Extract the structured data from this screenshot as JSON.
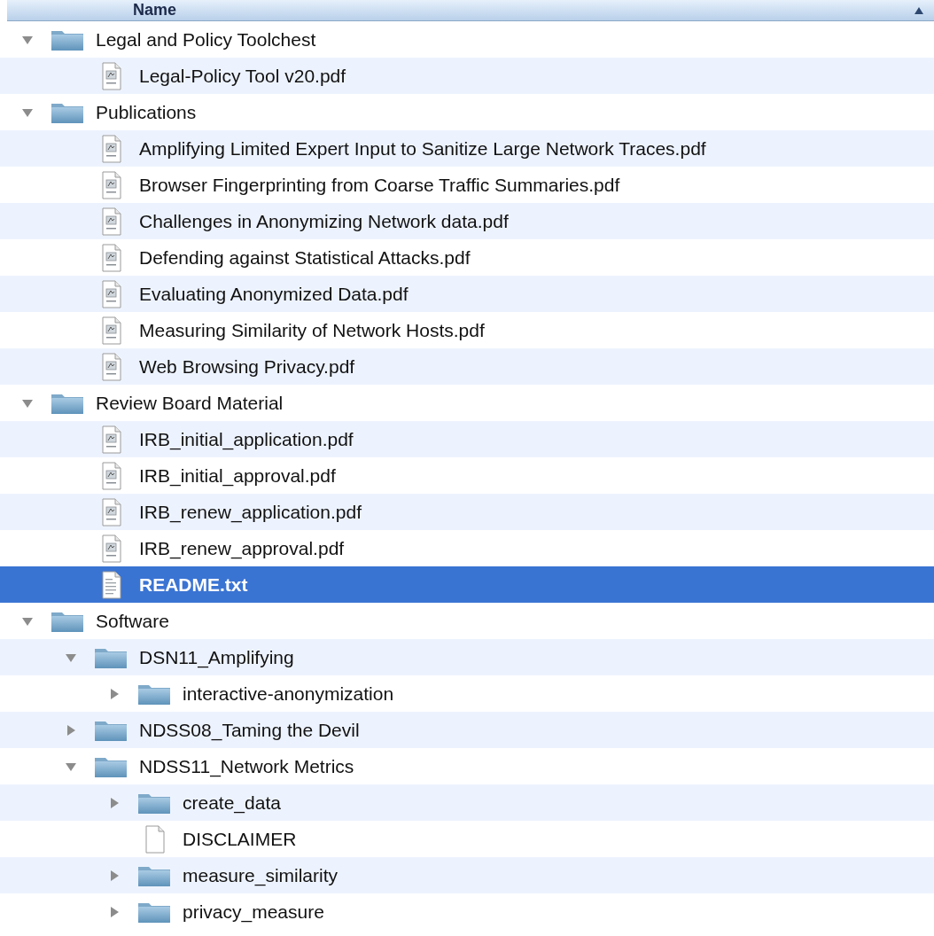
{
  "header": {
    "label": "Name"
  },
  "items": [
    {
      "kind": "folder",
      "name": "Legal and Policy Toolchest",
      "expanded": true,
      "selected": false,
      "children": [
        {
          "kind": "pdf",
          "name": "Legal-Policy Tool v20.pdf",
          "selected": false
        }
      ]
    },
    {
      "kind": "folder",
      "name": "Publications",
      "expanded": true,
      "selected": false,
      "children": [
        {
          "kind": "pdf",
          "name": "Amplifying Limited Expert Input to Sanitize Large Network Traces.pdf",
          "selected": false
        },
        {
          "kind": "pdf",
          "name": "Browser Fingerprinting from Coarse Traffic Summaries.pdf",
          "selected": false
        },
        {
          "kind": "pdf",
          "name": "Challenges in Anonymizing Network data.pdf",
          "selected": false
        },
        {
          "kind": "pdf",
          "name": "Defending against Statistical Attacks.pdf",
          "selected": false
        },
        {
          "kind": "pdf",
          "name": "Evaluating Anonymized Data.pdf",
          "selected": false
        },
        {
          "kind": "pdf",
          "name": "Measuring Similarity of Network Hosts.pdf",
          "selected": false
        },
        {
          "kind": "pdf",
          "name": "Web Browsing Privacy.pdf",
          "selected": false
        }
      ]
    },
    {
      "kind": "folder",
      "name": "Review Board Material",
      "expanded": true,
      "selected": false,
      "children": [
        {
          "kind": "pdf",
          "name": "IRB_initial_application.pdf",
          "selected": false
        },
        {
          "kind": "pdf",
          "name": "IRB_initial_approval.pdf",
          "selected": false
        },
        {
          "kind": "pdf",
          "name": "IRB_renew_application.pdf",
          "selected": false
        },
        {
          "kind": "pdf",
          "name": "IRB_renew_approval.pdf",
          "selected": false
        },
        {
          "kind": "text",
          "name": "README.txt",
          "selected": true
        }
      ]
    },
    {
      "kind": "folder",
      "name": "Software",
      "expanded": true,
      "selected": false,
      "children": [
        {
          "kind": "folder",
          "name": "DSN11_Amplifying",
          "expanded": true,
          "selected": false,
          "children": [
            {
              "kind": "folder",
              "name": "interactive-anonymization",
              "expanded": false,
              "selected": false
            }
          ]
        },
        {
          "kind": "folder",
          "name": "NDSS08_Taming the Devil",
          "expanded": false,
          "selected": false
        },
        {
          "kind": "folder",
          "name": "NDSS11_Network Metrics",
          "expanded": true,
          "selected": false,
          "children": [
            {
              "kind": "folder",
              "name": "create_data",
              "expanded": false,
              "selected": false
            },
            {
              "kind": "document",
              "name": "DISCLAIMER",
              "selected": false
            },
            {
              "kind": "folder",
              "name": "measure_similarity",
              "expanded": false,
              "selected": false
            },
            {
              "kind": "folder",
              "name": "privacy_measure",
              "expanded": false,
              "selected": false
            }
          ]
        }
      ]
    }
  ]
}
